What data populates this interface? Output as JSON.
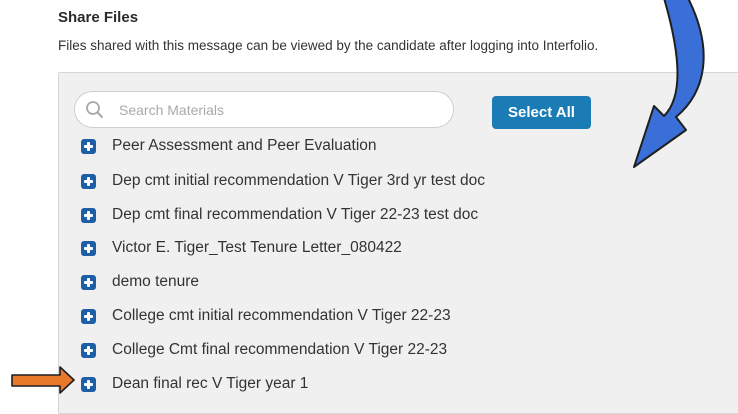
{
  "header": {
    "title": "Share Files",
    "description": "Files shared with this message can be viewed by the candidate after logging into Interfolio."
  },
  "search": {
    "placeholder": "Search Materials",
    "value": ""
  },
  "select_all_label": "Select All",
  "materials": [
    {
      "label": "Peer Assessment and Peer Evaluation",
      "icon": "plus-square-icon"
    },
    {
      "label": "Dep cmt initial recommendation V Tiger 3rd yr test doc",
      "icon": "plus-square-icon"
    },
    {
      "label": "Dep cmt final recommendation V Tiger 22-23 test doc",
      "icon": "plus-square-icon"
    },
    {
      "label": "Victor E. Tiger_Test Tenure Letter_080422",
      "icon": "plus-square-icon"
    },
    {
      "label": "demo tenure",
      "icon": "plus-square-icon"
    },
    {
      "label": "College cmt initial recommendation V Tiger 22-23",
      "icon": "plus-square-icon"
    },
    {
      "label": "College Cmt final recommendation V Tiger 22-23",
      "icon": "plus-square-icon"
    },
    {
      "label": "Dean final rec V Tiger year 1",
      "icon": "plus-square-icon"
    }
  ],
  "annotations": {
    "curved_arrow_color": "#3a6fd8",
    "pointer_arrow_color": "#e8782a"
  },
  "colors": {
    "button": "#1b7cb5",
    "plus_icon": "#1d5fa6",
    "panel": "#f0f0f0"
  }
}
